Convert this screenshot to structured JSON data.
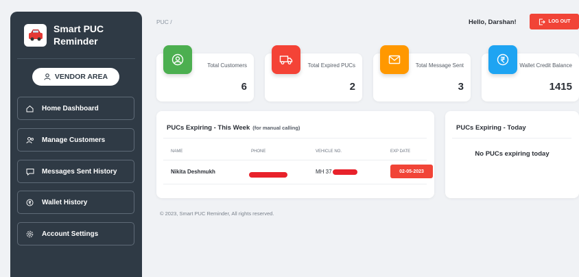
{
  "brand": {
    "title": "Smart PUC Reminder"
  },
  "vendor_button": {
    "label": "VENDOR AREA"
  },
  "nav": [
    {
      "label": "Home Dashboard",
      "icon": "home-icon"
    },
    {
      "label": "Manage Customers",
      "icon": "users-icon"
    },
    {
      "label": "Messages Sent History",
      "icon": "message-icon"
    },
    {
      "label": "Wallet History",
      "icon": "rupee-icon"
    },
    {
      "label": "Account Settings",
      "icon": "gear-icon"
    }
  ],
  "breadcrumb": "PUC /",
  "greeting": "Hello, Darshan!",
  "logout": {
    "label": "LOG OUT"
  },
  "stats": [
    {
      "label": "Total Customers",
      "value": "6",
      "color": "#4caf50",
      "icon": "user-circle-icon"
    },
    {
      "label": "Total Expired PUCs",
      "value": "2",
      "color": "#f44336",
      "icon": "truck-icon"
    },
    {
      "label": "Total Message Sent",
      "value": "3",
      "color": "#ff9800",
      "icon": "envelope-icon"
    },
    {
      "label": "Wallet Credit Balance",
      "value": "1415",
      "color": "#1ea4f2",
      "icon": "rupee-icon"
    }
  ],
  "week_panel": {
    "title": "PUCs Expiring - This Week",
    "subtitle": "(for manual calling)",
    "headers": [
      "NAME",
      "PHONE",
      "VEHICLE NO.",
      "EXP DATE"
    ],
    "rows": [
      {
        "name": "Nikita Deshmukh",
        "vehicle_prefix": "MH 37",
        "exp_date": "02-05-2023"
      }
    ]
  },
  "today_panel": {
    "title": "PUCs Expiring - Today",
    "empty_text": "No PUCs expiring today"
  },
  "footer": "© 2023, Smart PUC Reminder, All rights reserved."
}
